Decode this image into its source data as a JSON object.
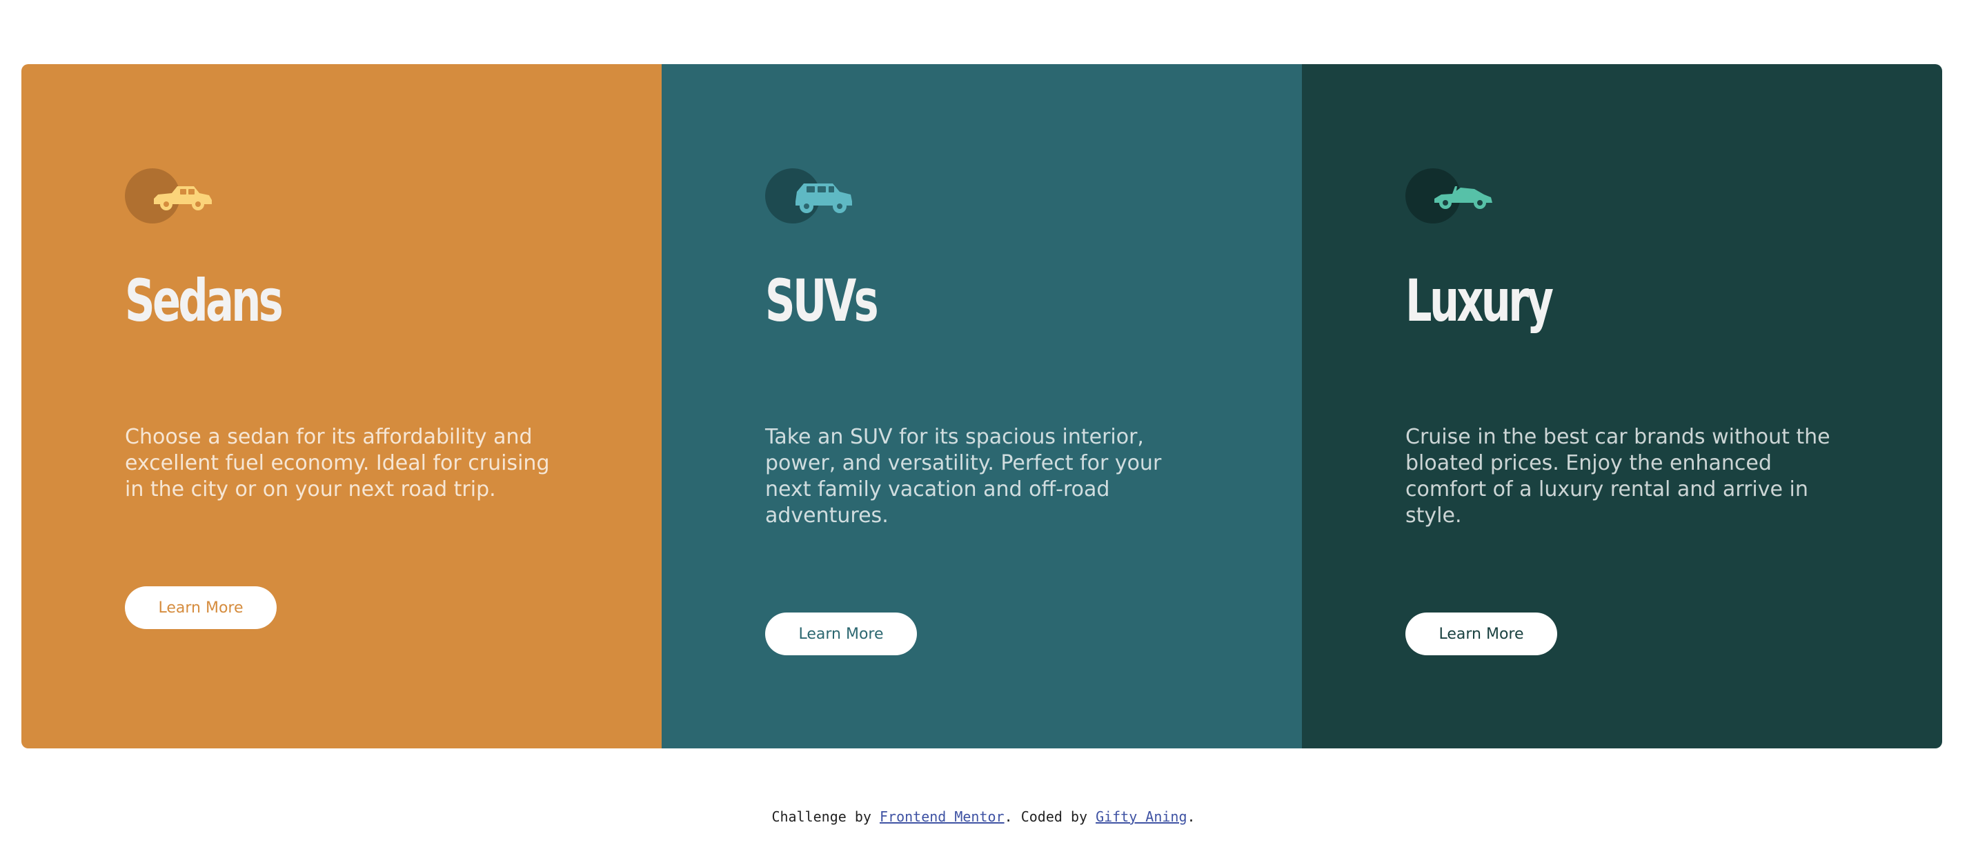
{
  "cards": [
    {
      "title": "Sedans",
      "description": "Choose a sedan for its affordability and excellent fuel economy. Ideal for cruising in the city or on your next road trip.",
      "button_label": "Learn More",
      "icon": "sedan-car-icon",
      "colors": {
        "background": "#d58c3e",
        "icon": "#fbd47a",
        "circle": "#b07030",
        "button_text": "#d58c3e"
      }
    },
    {
      "title": "SUVs",
      "description": "Take an SUV for its spacious interior, power, and versatility. Perfect for your next family vacation and off-road adventures.",
      "button_label": "Learn More",
      "icon": "suv-car-icon",
      "colors": {
        "background": "#2c6770",
        "icon": "#5fb9c4",
        "circle": "#1d4a50",
        "button_text": "#2c6770"
      }
    },
    {
      "title": "Luxury",
      "description": "Cruise in the best car brands without the bloated prices. Enjoy the enhanced comfort of a luxury rental and arrive in style.",
      "button_label": "Learn More",
      "icon": "luxury-car-icon",
      "colors": {
        "background": "#1a4140",
        "icon": "#57c1a8",
        "circle": "#112e2d",
        "button_text": "#1a4140"
      }
    }
  ],
  "footer": {
    "prefix": "Challenge by ",
    "link1": "Frontend Mentor",
    "middle": ". Coded by ",
    "link2": "Gifty Aning",
    "suffix": "."
  }
}
